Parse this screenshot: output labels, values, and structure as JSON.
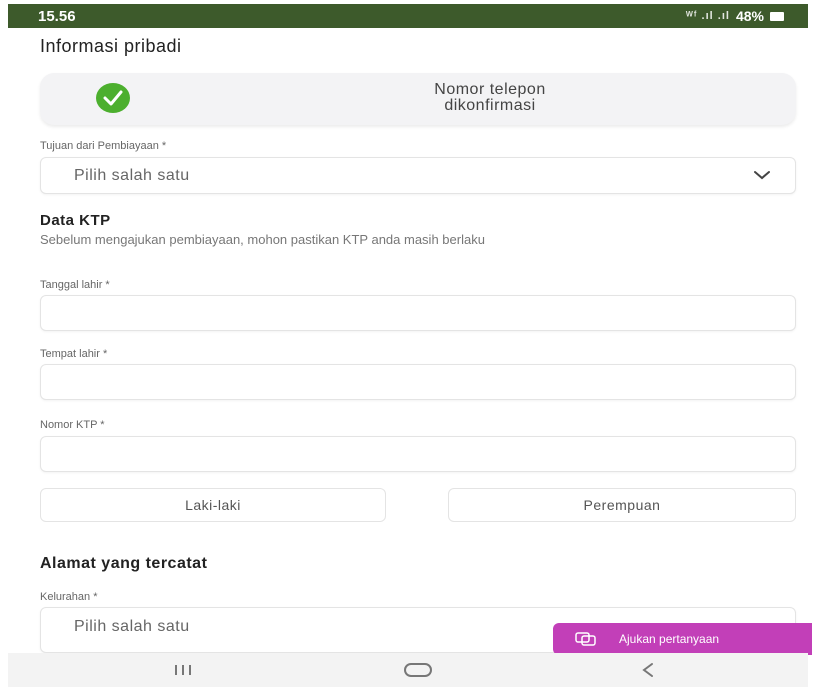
{
  "status_bar": {
    "time": "15.56",
    "signal_text": "ᵂᶠ .ıl .ıl",
    "battery_percent": "48%"
  },
  "personal_info": {
    "title": "Informasi pribadi",
    "phone_confirmed_line1": "Nomor telepon",
    "phone_confirmed_line2": "dikonfirmasi"
  },
  "purpose": {
    "label": "Tujuan dari Pembiayaan *",
    "selected": "Pilih salah satu"
  },
  "ktp": {
    "title": "Data KTP",
    "description": "Sebelum mengajukan pembiayaan, mohon pastikan KTP anda masih berlaku",
    "birth_date_label": "Tanggal lahir *",
    "birth_date_value": "",
    "birth_place_label": "Tempat lahir *",
    "birth_place_value": "",
    "ktp_number_label": "Nomor KTP *",
    "ktp_number_value": "",
    "gender_male": "Laki-laki",
    "gender_female": "Perempuan"
  },
  "address": {
    "title": "Alamat yang tercatat",
    "sub_district_label": "Kelurahan *",
    "selected": "Pilih salah satu"
  },
  "help": {
    "label": "Ajukan pertanyaan",
    "icon": "chat-bubbles-icon",
    "color": "#c23fb8"
  },
  "nav": {
    "recents_icon": "recents-icon",
    "home_icon": "home-icon",
    "back_icon": "back-icon"
  },
  "colors": {
    "status_bar": "#3d5a2b",
    "check": "#4caf2e"
  }
}
